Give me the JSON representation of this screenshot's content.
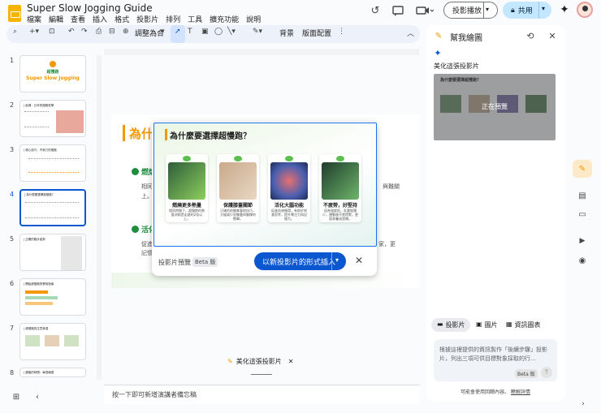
{
  "app": {
    "title": "Super Slow Jogging Guide",
    "menu": [
      "檔案",
      "編輯",
      "查看",
      "插入",
      "格式",
      "投影片",
      "排列",
      "工具",
      "擴充功能",
      "說明"
    ]
  },
  "header": {
    "slideshow_label": "投影播放",
    "share_label": "共用"
  },
  "toolbar": {
    "zoom_label": "調整為合",
    "background_label": "背景",
    "layout_label": "版面配置"
  },
  "filmstrip": {
    "numbers": [
      "1",
      "2",
      "3",
      "4",
      "5",
      "6",
      "7",
      "8"
    ],
    "slide1_title": "超慢跑",
    "slide1_subtitle": "Super Slow Jogging",
    "slide2_title": "| 起源：日本的慢跑哲學",
    "slide3_title": "| 核心技巧：不費力的慢跑",
    "slide4_title": "| 為什麼要選擇超慢跑？",
    "slide5_title": "| 正確的跑步姿勢",
    "slide6_title": "| 開始超慢跑的實用指南",
    "slide7_title": "| 超慢跑的注意事項",
    "slide8_title": "| 建議的時間：每週練習"
  },
  "slide": {
    "title": "為什",
    "sub1": "燃燒",
    "sub2": "活化",
    "frag1": "相同",
    "frag2": "上。",
    "frag3": "促進",
    "frag4": "記憶",
    "frag5": "與難關",
    "frag6": "家，更"
  },
  "preview": {
    "title": "為什麼要選擇超慢跑？",
    "cards": [
      {
        "title": "燃燒更多熱量",
        "desc": "相同時間下，超慢跑的熱量消耗是走路的2倍以上。"
      },
      {
        "title": "保護膝蓋關節",
        "desc": "正確的前腳掌著地技巧，大幅減少對膝蓋與腳踝的衝擊。"
      },
      {
        "title": "活化大腦功能",
        "desc": "促進血液循環，有助於刺激思考，提升專注力與記憶力。"
      },
      {
        "title": "不疲勞，好堅持",
        "desc": "因為強度低，乳酸堆積少，運動後不覺得累，更容易養成習慣。"
      }
    ],
    "footer_label": "投影片預覽",
    "beta": "Beta 版",
    "insert_label": "以新投影片的形式插入"
  },
  "bottom_chip": {
    "label": "美化這張投影片"
  },
  "notes": {
    "placeholder": "按一下即可新增演講者備忘稿"
  },
  "panel": {
    "title": "幫我繪圖",
    "section_label": "美化這張投影片",
    "thumb_status": "正在預覽",
    "tabs": [
      "投影片",
      "圖片",
      "資訊圖表"
    ],
    "prompt_text": "根據這裡提供的資訊製作「後續步驟」投影片，列出三項可供目標對象採取的行...",
    "prompt_beta": "Beta 版",
    "disclaimer_prefix": "可能會使用回饋內容。",
    "disclaimer_link": "瞭解詳情"
  },
  "colors": {
    "accent": "#0b57d0",
    "slide_orange": "#f29900",
    "slide_green": "#1e8e3e"
  }
}
